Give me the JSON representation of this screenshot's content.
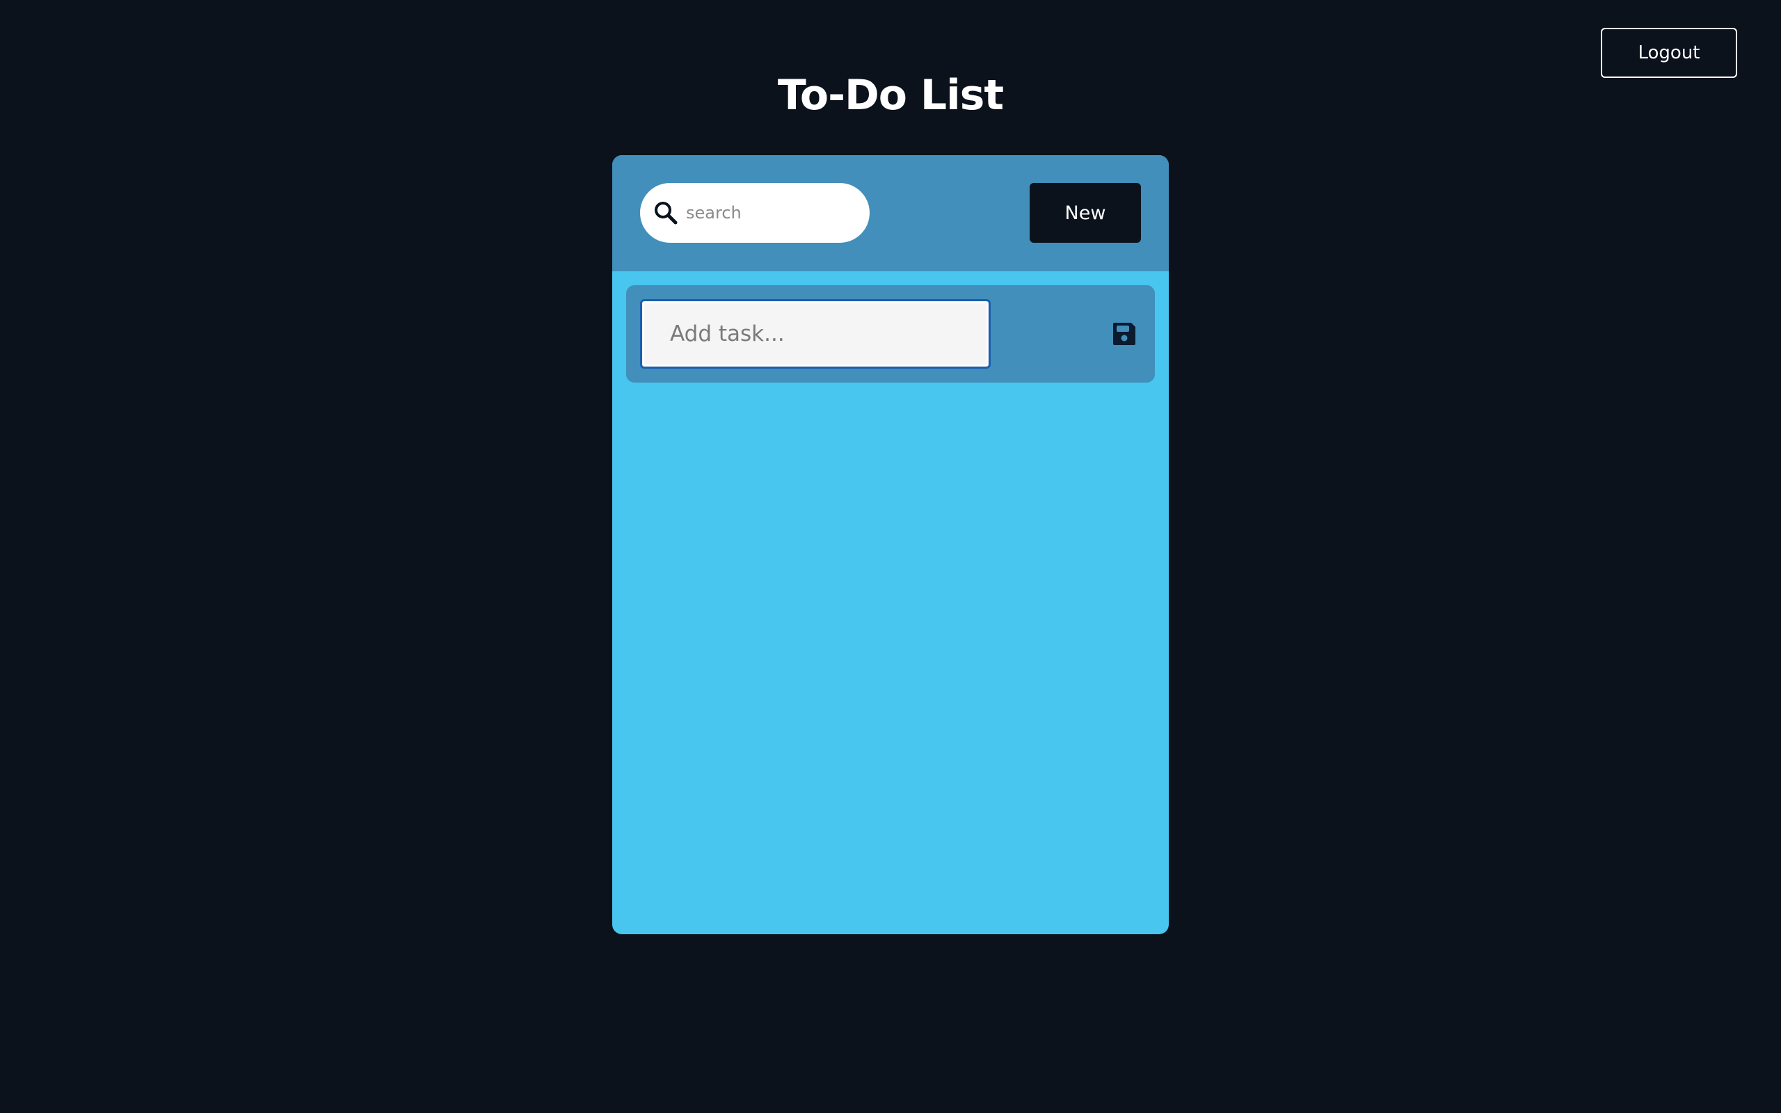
{
  "header": {
    "logout_label": "Logout",
    "title": "To-Do List"
  },
  "toolbar": {
    "search_placeholder": "search",
    "search_icon": "search-icon",
    "new_label": "New"
  },
  "add_task": {
    "placeholder": "Add task...",
    "value": "",
    "save_icon": "floppy-disk-save-icon"
  },
  "colors": {
    "background": "#0b121c",
    "card": "#48c6f0",
    "card_header": "#418fba",
    "button_dark": "#0b121c",
    "input_focus_border": "#1a5fb0"
  }
}
